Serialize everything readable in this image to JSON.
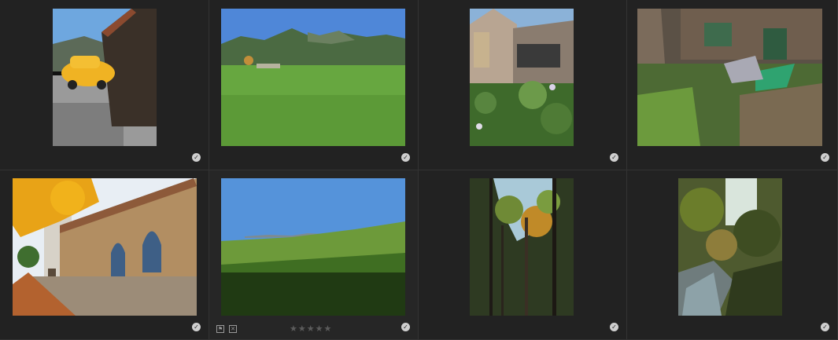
{
  "grid": {
    "rows": 2,
    "cols": 4,
    "items": [
      {
        "subject": "yellow-car-by-wooden-barn",
        "picked": true
      },
      {
        "subject": "green-meadow-with-mountains",
        "picked": true
      },
      {
        "subject": "house-with-garden-plants",
        "picked": true
      },
      {
        "subject": "old-wooden-shed-with-ferns",
        "picked": true
      },
      {
        "subject": "church-wall-with-autumn-tree",
        "picked": true
      },
      {
        "subject": "green-hill-under-blue-sky",
        "picked": true,
        "hovered": true,
        "rating": 0,
        "stars_max": 5
      },
      {
        "subject": "forest-canopy-autumn",
        "picked": true
      },
      {
        "subject": "stream-in-forest",
        "picked": true
      }
    ]
  },
  "icons": {
    "pick": "check-circle-icon",
    "flag": "flag-icon",
    "reject": "reject-icon",
    "star": "star-icon"
  },
  "colors": {
    "background": "#262626",
    "cell": "#222222",
    "separator": "#333333",
    "check": "#cfcfcf"
  }
}
